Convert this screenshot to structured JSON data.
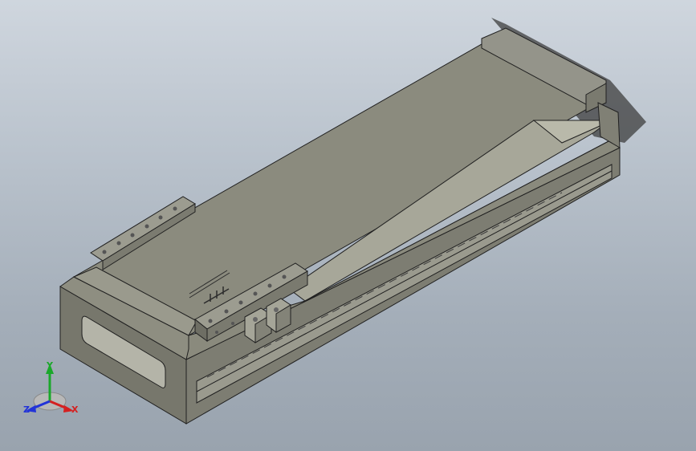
{
  "triad": {
    "x_label": "X",
    "y_label": "Y",
    "z_label": "Z",
    "x_color": "#d42020",
    "y_color": "#1aa82a",
    "z_color": "#2233d8"
  },
  "model": {
    "mark_text": "",
    "body_color": "#8f8f82",
    "edge_color": "#202020"
  }
}
